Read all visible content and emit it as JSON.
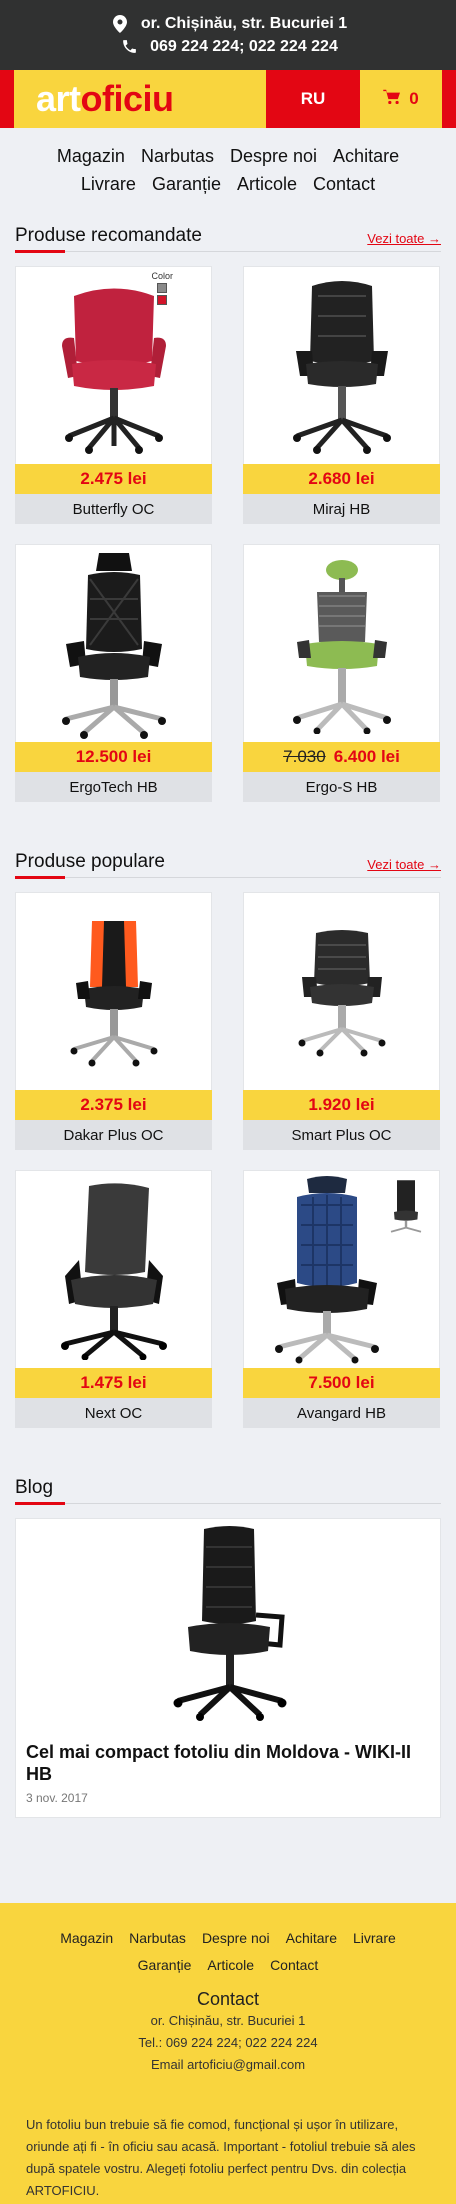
{
  "topbar": {
    "address": "or. Chișinău, str. Bucuriei 1",
    "phones": "069 224 224; 022 224 224"
  },
  "header": {
    "logo_part1": "art",
    "logo_part2": "oficiu",
    "lang": "RU",
    "cart_count": "0"
  },
  "nav": {
    "row1": [
      "Magazin",
      "Narbutas",
      "Despre noi",
      "Achitare"
    ],
    "row2": [
      "Livrare",
      "Garanție",
      "Articole",
      "Contact"
    ]
  },
  "recommended": {
    "title": "Produse recomandate",
    "see_all": "Vezi toate →",
    "products": [
      {
        "name": "Butterfly OC",
        "price": "2.475 lei",
        "old_price": "",
        "swatch_label": "Color"
      },
      {
        "name": "Miraj HB",
        "price": "2.680 lei",
        "old_price": ""
      },
      {
        "name": "ErgoTech HB",
        "price": "12.500 lei",
        "old_price": ""
      },
      {
        "name": "Ergo-S HB",
        "price": "6.400 lei",
        "old_price": "7.030"
      }
    ]
  },
  "popular": {
    "title": "Produse populare",
    "see_all": "Vezi toate →",
    "products": [
      {
        "name": "Dakar Plus OC",
        "price": "2.375 lei"
      },
      {
        "name": "Smart Plus OC",
        "price": "1.920 lei"
      },
      {
        "name": "Next OC",
        "price": "1.475 lei"
      },
      {
        "name": "Avangard HB",
        "price": "7.500 lei"
      }
    ]
  },
  "blog": {
    "title": "Blog",
    "post_title": "Cel mai compact fotoliu din Moldova - WIKI-II HB",
    "post_date": "3 nov. 2017"
  },
  "footer": {
    "row1": [
      "Magazin",
      "Narbutas",
      "Despre noi",
      "Achitare",
      "Livrare"
    ],
    "row2": [
      "Garanție",
      "Articole",
      "Contact"
    ],
    "contact_title": "Contact",
    "address": "or. Chișinău, str. Bucuriei 1",
    "phones": "Tel.: 069 224 224; 022 224 224",
    "email": "Email artoficiu@gmail.com",
    "description": "Un fotoliu bun trebuie să fie comod, funcțional și ușor în utilizare, oriunde ați fi - în oficiu sau acasă. Important - fotoliul trebuie să ales după spatele vostru. Alegeți fotoliu perfect pentru Dvs. din colecția ARTOFICIU."
  },
  "colors": {
    "brand_red": "#e30613",
    "brand_yellow": "#f9d53e",
    "topbar_dark": "#303131"
  }
}
